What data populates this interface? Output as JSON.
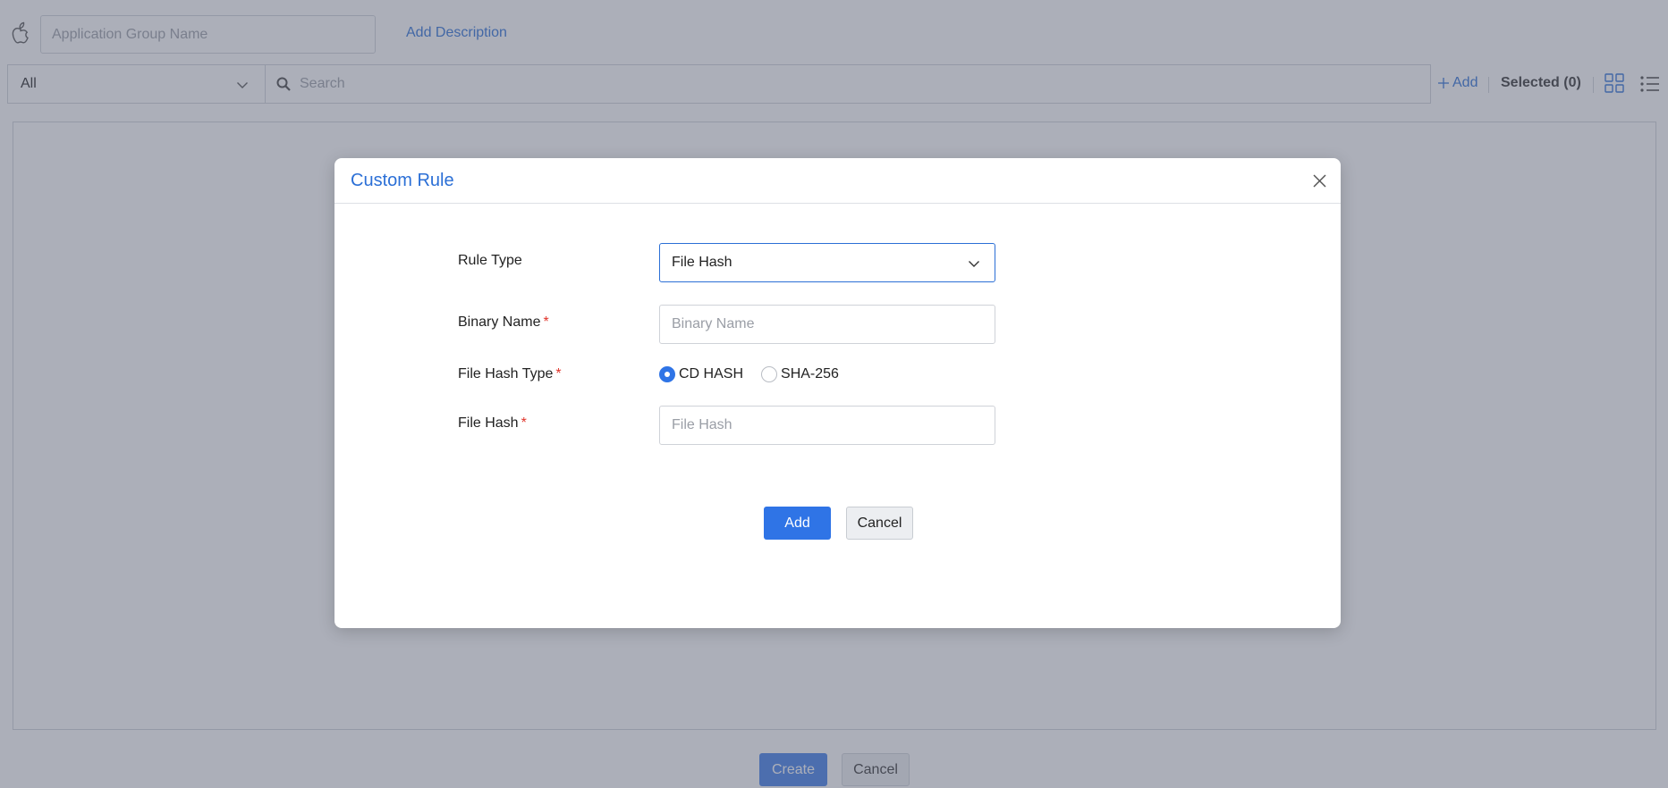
{
  "header": {
    "group_name_placeholder": "Application Group Name",
    "add_description_label": "Add Description"
  },
  "toolbar": {
    "filter_value": "All",
    "search_placeholder": "Search",
    "add_label": "Add",
    "selected_label": "Selected (0)"
  },
  "footer": {
    "create_label": "Create",
    "cancel_label": "Cancel"
  },
  "modal": {
    "title": "Custom Rule",
    "rule_type_label": "Rule Type",
    "rule_type_value": "File Hash",
    "binary_name_label": "Binary Name",
    "binary_name_placeholder": "Binary Name",
    "file_hash_type_label": "File Hash Type",
    "hash_options": [
      "CD HASH",
      "SHA-256"
    ],
    "selected_hash_option": "CD HASH",
    "file_hash_label": "File Hash",
    "file_hash_placeholder": "File Hash",
    "required_marker": "*",
    "add_label": "Add",
    "cancel_label": "Cancel"
  },
  "colors": {
    "accent": "#2f74e6",
    "link": "#2b6fd6",
    "required": "#e0352b",
    "overlay": "rgba(90, 95, 115, 0.5)"
  },
  "icons": {
    "platform": "apple-icon",
    "search": "search-icon",
    "close": "close-icon",
    "dropdown": "chevron-down-icon",
    "grid_view": "grid-view-icon",
    "list_view": "list-view-icon"
  }
}
